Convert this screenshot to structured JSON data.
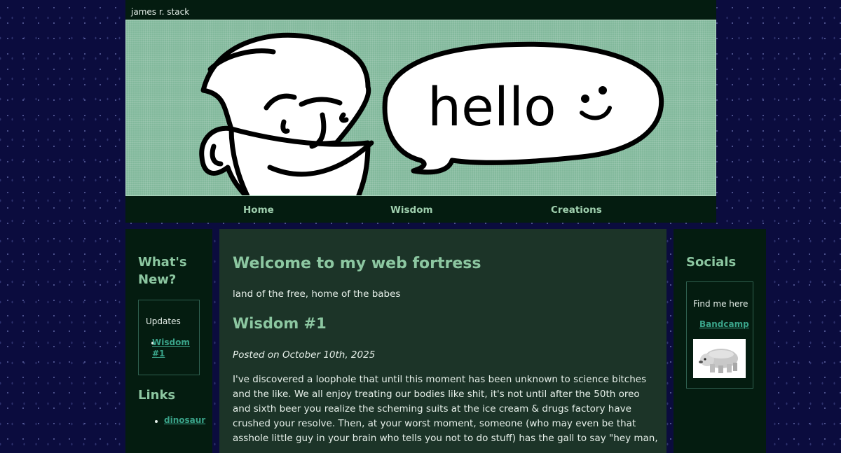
{
  "site": {
    "title": "james r. stack"
  },
  "banner": {
    "speech": "hello"
  },
  "nav": {
    "items": [
      "Home",
      "Wisdom",
      "Creations"
    ]
  },
  "left_sidebar": {
    "whats_new_heading": "What's New?",
    "updates_label": "Updates",
    "updates_items": [
      "Wisdom #1"
    ],
    "links_heading": "Links",
    "links_items": [
      "dinosaur"
    ]
  },
  "main": {
    "title": "Welcome to my web fortress",
    "tagline": "land of the free, home of the babes",
    "post_title": "Wisdom #1",
    "post_date": "Posted on October 10th, 2025",
    "post_body": [
      "I've discovered a loophole that until this moment has been unknown to science bitches",
      "and the like. We all enjoy treating our bodies like shit, it's not until after the 50th oreo",
      "and sixth beer you realize the scheming suits at the ice cream & drugs factory have",
      "crushed your resolve. Then, at your worst moment, someone (who may even be that",
      "asshole little guy in your brain who tells you not to do stuff) has the gall to say \"hey man,"
    ]
  },
  "right_sidebar": {
    "socials_heading": "Socials",
    "find_me_label": "Find me here",
    "bandcamp_link": "Bandcamp",
    "image_icon": "polar-bear-icon"
  },
  "colors": {
    "page_bg": "#0b0c3e",
    "panel_dark": "#041c10",
    "main_bg": "#1c3428",
    "banner_green": "#82b99c",
    "heading_green": "#8cc7a1",
    "link_teal": "#3aa48a"
  }
}
